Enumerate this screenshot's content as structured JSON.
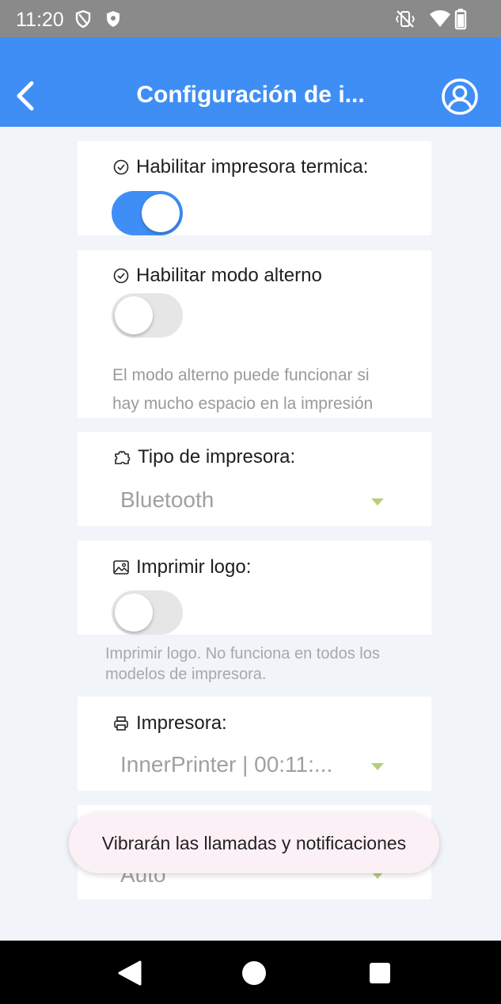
{
  "status_bar": {
    "time": "11:20"
  },
  "app_bar": {
    "title": "Configuración de i..."
  },
  "settings": {
    "thermal_printer": {
      "label": "Habilitar impresora termica:",
      "enabled": true
    },
    "alternate_mode": {
      "label": "Habilitar modo alterno",
      "enabled": false,
      "help_line1": "El modo alterno puede funcionar si",
      "help_line2": "hay mucho espacio en la impresión"
    },
    "printer_type": {
      "label": "Tipo de impresora:",
      "value": "Bluetooth"
    },
    "print_logo": {
      "label": "Imprimir logo:",
      "enabled": false,
      "help_line1": "Imprimir logo. No funciona en todos los",
      "help_line2": "modelos de impresora."
    },
    "printer": {
      "label": "Impresora:",
      "value": "InnerPrinter | 00:11:..."
    },
    "partial_select": {
      "value": "Auto"
    }
  },
  "toast": {
    "message": "Vibrarán las llamadas y notificaciones"
  },
  "colors": {
    "accent": "#3f8ef5",
    "dropdown_arrow": "#b6cf7a",
    "page_bg": "#f1f4f8"
  }
}
